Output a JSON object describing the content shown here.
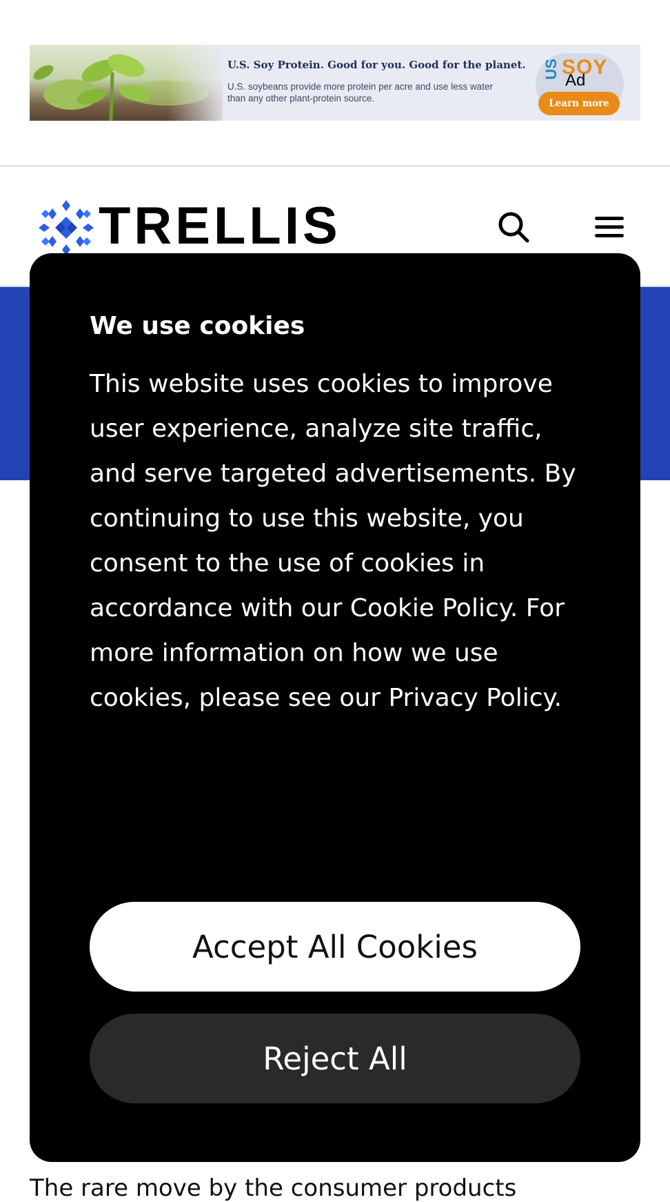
{
  "ad": {
    "headline": "U.S. Soy Protein. Good for you. Good for the planet.",
    "body": "U.S. soybeans provide more protein per acre and use less water than any other plant-protein source.",
    "logo_us": "US",
    "logo_soy": "SOY",
    "tag": "Ad",
    "cta": "Learn more",
    "image_icon": "soybean-sprout-photo",
    "colors": {
      "accent": "#e88b17",
      "logo_blue": "#1d8cb9",
      "background": "#e9ebf4"
    }
  },
  "header": {
    "logo_text": "TRELLIS",
    "logo_icon": "trellis-lattice-icon",
    "search_icon": "search-icon",
    "menu_icon": "hamburger-menu-icon",
    "colors": {
      "brand": "#2343b5",
      "text": "#000000"
    }
  },
  "cookie_banner": {
    "title": "We use cookies",
    "body": "This website uses cookies to improve user experience, analyze site traffic, and serve targeted advertisements. By continuing to use this website, you consent to the use of cookies in accordance with our Cookie Policy. For more information on how we use cookies, please see our Privacy Policy.",
    "accept_label": "Accept All Cookies",
    "reject_label": "Reject All",
    "colors": {
      "background": "#000000",
      "accept_bg": "#ffffff",
      "reject_bg": "#2a2a2a"
    }
  },
  "article": {
    "snippet": "The rare move by the consumer products"
  }
}
